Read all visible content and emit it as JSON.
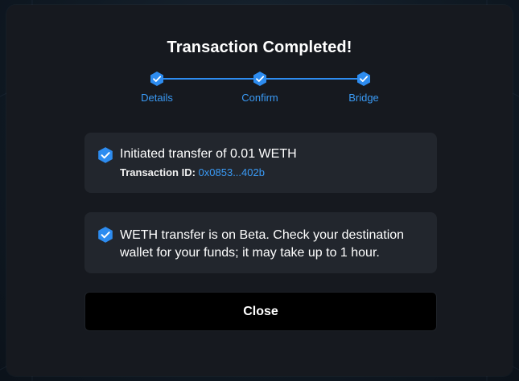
{
  "modal": {
    "title": "Transaction Completed!"
  },
  "stepper": {
    "accent_color": "#2d8cf0",
    "steps": [
      {
        "label": "Details",
        "icon": "check-hex-icon",
        "completed": true
      },
      {
        "label": "Confirm",
        "icon": "check-hex-icon",
        "completed": true
      },
      {
        "label": "Bridge",
        "icon": "check-hex-icon",
        "completed": true
      }
    ]
  },
  "transfer_card": {
    "icon": "check-hex-icon",
    "message": "Initiated transfer of 0.01 WETH",
    "tx_label": "Transaction ID:",
    "tx_id": "0x0853...402b"
  },
  "notice_card": {
    "icon": "check-hex-icon",
    "message": "WETH transfer is on Beta. Check your destination wallet for your funds; it may take up to 1 hour."
  },
  "actions": {
    "close_label": "Close"
  }
}
